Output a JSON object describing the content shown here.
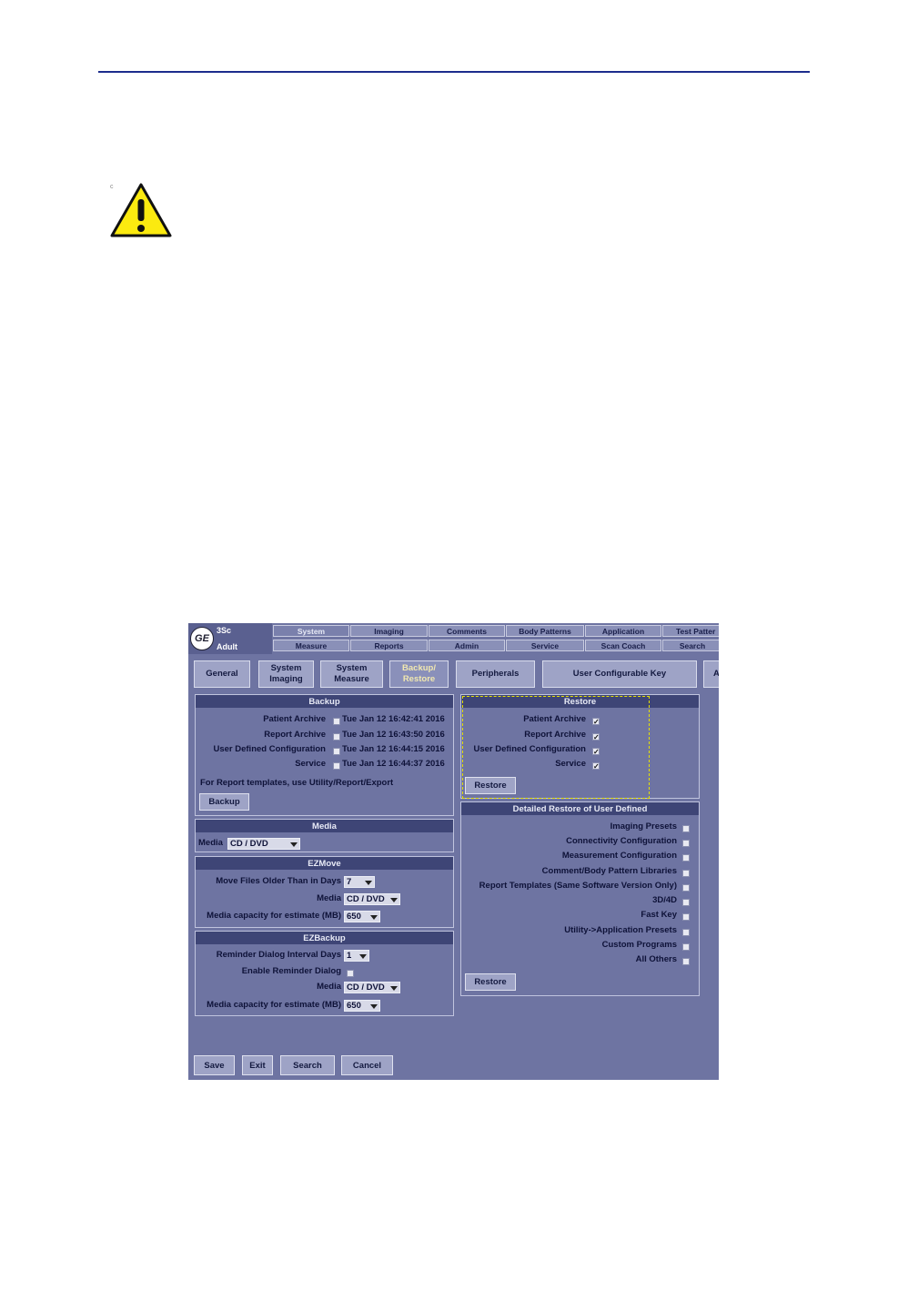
{
  "page": {
    "small_mark": "c"
  },
  "header": {
    "probe": "3Sc",
    "preset": "Adult"
  },
  "tabs_top": [
    "System",
    "Imaging",
    "Comments",
    "Body Patterns",
    "Application",
    "Test Patter"
  ],
  "tabs_bottom": [
    "Measure",
    "Reports",
    "Admin",
    "Service",
    "Scan Coach",
    "Search"
  ],
  "subtabs": {
    "general": "General",
    "system_imaging": [
      "System",
      "Imaging"
    ],
    "system_measure": [
      "System",
      "Measure"
    ],
    "backup_restore": [
      "Backup/",
      "Restore"
    ],
    "peripherals": "Peripherals",
    "user_key": "User Configurable Key",
    "more": "A"
  },
  "backup": {
    "title": "Backup",
    "items": [
      {
        "label": "Patient Archive",
        "timestamp": "Tue Jan 12 16:42:41 2016"
      },
      {
        "label": "Report Archive",
        "timestamp": "Tue Jan 12 16:43:50 2016"
      },
      {
        "label": "User Defined Configuration",
        "timestamp": "Tue Jan 12 16:44:15 2016"
      },
      {
        "label": "Service",
        "timestamp": "Tue Jan 12 16:44:37 2016"
      }
    ],
    "note": "For Report templates, use Utility/Report/Export",
    "button": "Backup"
  },
  "media": {
    "title": "Media",
    "label": "Media",
    "value": "CD / DVD"
  },
  "ezmove": {
    "title": "EZMove",
    "older_label": "Move Files Older Than in Days",
    "older_value": "7",
    "media_label": "Media",
    "media_value": "CD / DVD",
    "capacity_label": "Media capacity for estimate (MB)",
    "capacity_value": "650"
  },
  "ezbackup": {
    "title": "EZBackup",
    "interval_label": "Reminder Dialog Interval Days",
    "interval_value": "1",
    "enable_label": "Enable Reminder Dialog",
    "media_label": "Media",
    "media_value": "CD / DVD",
    "capacity_label": "Media capacity for estimate (MB)",
    "capacity_value": "650"
  },
  "restore": {
    "title": "Restore",
    "items": [
      "Patient Archive",
      "Report Archive",
      "User Defined Configuration",
      "Service"
    ],
    "checked_mark": "✓",
    "button": "Restore"
  },
  "detailed_restore": {
    "title": "Detailed Restore of User Defined",
    "items": [
      "Imaging Presets",
      "Connectivity Configuration",
      "Measurement Configuration",
      "Comment/Body Pattern Libraries",
      "Report Templates (Same Software Version Only)",
      "3D/4D",
      "Fast Key",
      "Utility->Application Presets",
      "Custom Programs",
      "All Others"
    ],
    "button": "Restore"
  },
  "footer": {
    "save": "Save",
    "exit": "Exit",
    "search": "Search",
    "cancel": "Cancel"
  },
  "colors": {
    "rule": "#1c2c8c",
    "warning_yellow": "#fbea10",
    "panel_bg": "#6e74a2",
    "header_bg": "#3e4576",
    "highlight": "#e6e000"
  }
}
